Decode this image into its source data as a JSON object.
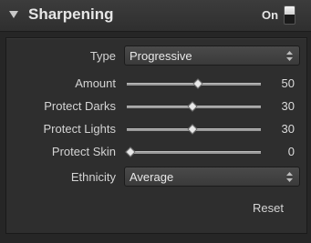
{
  "header": {
    "title": "Sharpening",
    "on_label": "On",
    "toggle_on": true
  },
  "controls": {
    "type": {
      "label": "Type",
      "value": "Progressive"
    },
    "amount": {
      "label": "Amount",
      "value": "50",
      "level": 0.5
    },
    "protect_darks": {
      "label": "Protect Darks",
      "value": "30",
      "level": 0.46
    },
    "protect_lights": {
      "label": "Protect Lights",
      "value": "30",
      "level": 0.46
    },
    "protect_skin": {
      "label": "Protect Skin",
      "value": "0",
      "level": 0.0
    },
    "ethnicity": {
      "label": "Ethnicity",
      "value": "Average"
    }
  },
  "reset_label": "Reset",
  "icons": {
    "collapse": "triangle-down-icon",
    "stepper": "up-down-stepper-icon"
  },
  "colors": {
    "panel_bg": "#2e2e2e",
    "text": "#d4d4d4",
    "track": "#9a9a9a",
    "thumb": "#e9e9e9"
  }
}
